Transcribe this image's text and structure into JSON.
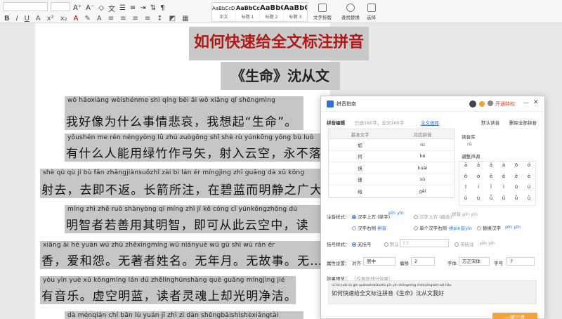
{
  "ribbon": {
    "styles": [
      {
        "sample": "AaBbCcDd",
        "name": "正文"
      },
      {
        "sample": "AaBbCcDd",
        "name": "标题 1"
      },
      {
        "sample": "AaBbC",
        "name": "标题 2"
      },
      {
        "sample": "AaBbC",
        "name": "标题 3"
      }
    ],
    "tools": [
      {
        "label": "文字排版",
        "icon": "text-layout-icon"
      },
      {
        "label": "查找替换",
        "icon": "find-replace-icon"
      },
      {
        "label": "选择",
        "icon": "select-icon"
      }
    ]
  },
  "document": {
    "title": "如何快速给全文标注拼音",
    "subtitle": "《生命》沈从文",
    "lines": [
      {
        "pinyin": "wǒ hǎoxiàng wèishénme shì qíng bēi āi      wǒ xiǎng qǐ   shēngmìng",
        "hanzi": "我好像为什么事情悲哀，我想起“生命”。"
      },
      {
        "pinyin": "yǒushén me rén néngyòng lǜ zhú zuògōng shǐ   shè rù yúnkōng    yǒng bù luò",
        "hanzi": "有什么人能用绿竹作弓矢，射入云空，永不落"
      },
      {
        "pinyin": "shè qù   qù jí bù fǎn  zhǎngjiànsuǒzhǐ  zài bì lán ér míngjìng zhī guǎng dà xū kōng",
        "hanzi": "射去，去即不返。长箭所注，在碧蓝而明静之广大虚空"
      },
      {
        "pinyin": "míng zhì zhě ruò shànyòng qí míng zhì    jí kě cóng cǐ yúnkōngzhōng   dú",
        "hanzi": "明智者若善用其明智，即可从此云空中，读"
      },
      {
        "pinyin": "xiāng   ài hé yuàn  wú zhù zhěxìngmíng   wú niányuè   wú gù shì   wú     rán ér",
        "hanzi": "香，爱和怨。无著者姓名。无年月。无故事。无……然而"
      },
      {
        "pinyin": "yǒu yīn yuè  xū kōngmíng lán  dú zhělínghúnshàng què guāng míngjìng jié",
        "hanzi": "有音乐。虚空明蓝，读者灵魂上却光明净洁。"
      },
      {
        "pinyin": "dà ménqián chí bān lù yuán   jī zhì zì   dàn shēngbǎishìshèxiǎngtài",
        "hanzi": ""
      }
    ]
  },
  "panel": {
    "title": "拼音指南",
    "vip_label": "开通特权",
    "tab_label": "拼音编辑",
    "stats": "已选160字，全文160字",
    "stats_link": "全文选择",
    "default_label": "默认读音",
    "delete_label": "删除全部拼音",
    "table_headers": [
      "基准文字",
      "对应拼音"
    ],
    "table_rows": [
      {
        "char": "如",
        "pinyin": "rú"
      },
      {
        "char": "何",
        "pinyin": "hé"
      },
      {
        "char": "快",
        "pinyin": "kuài"
      },
      {
        "char": "速",
        "pinyin": "sù"
      },
      {
        "char": "给",
        "pinyin": "gěi"
      }
    ],
    "reading_label": "读音库",
    "reading_value": "rú",
    "tone_label": "调整声调",
    "tones": [
      "ā",
      "á",
      "ǎ",
      "à",
      "ō",
      "ó",
      "ǒ",
      "ò",
      "ē",
      "é",
      "ě",
      "è",
      "ī",
      "í",
      "ǐ",
      "ì",
      "ū",
      "ú",
      "ǔ",
      "ù",
      "ǖ",
      "ǘ",
      "ǚ",
      "ǜ"
    ],
    "style_label": "注音样式：",
    "style_opts": [
      "汉字上方 (单字)",
      "汉字上方 (组合)",
      "汉字右侧",
      "单个汉字右侧",
      "替换汉字"
    ],
    "style_samples": [
      "pīn yīn",
      "拼音 pīn yīn",
      "拼音",
      "拼pīn音yīn",
      "pīn yīn"
    ],
    "bracket_label": "括号样式：",
    "bracket_opts": [
      "无括号",
      "默认",
      "( )",
      "带括注"
    ],
    "prop_label": "属性设置：",
    "align_label": "对齐",
    "align_value": "居中",
    "offset_label": "偏移",
    "offset_value": "2",
    "font_label": "字体",
    "font_value": "方正宋体",
    "size_label": "字号",
    "size_value": "7",
    "preview_label": "效果预览：",
    "preview_hint": "（仅展现部分效果）",
    "preview_pinyin": "rú  hé kuài sù  gěi quánwénbiāozhù pīn yīn   shēngmìng   shéncóngwén wǒ hǎo",
    "preview_text": "如何快速给全文标注拼音《生命》沈从文我好",
    "confirm_label": "一键注音"
  }
}
